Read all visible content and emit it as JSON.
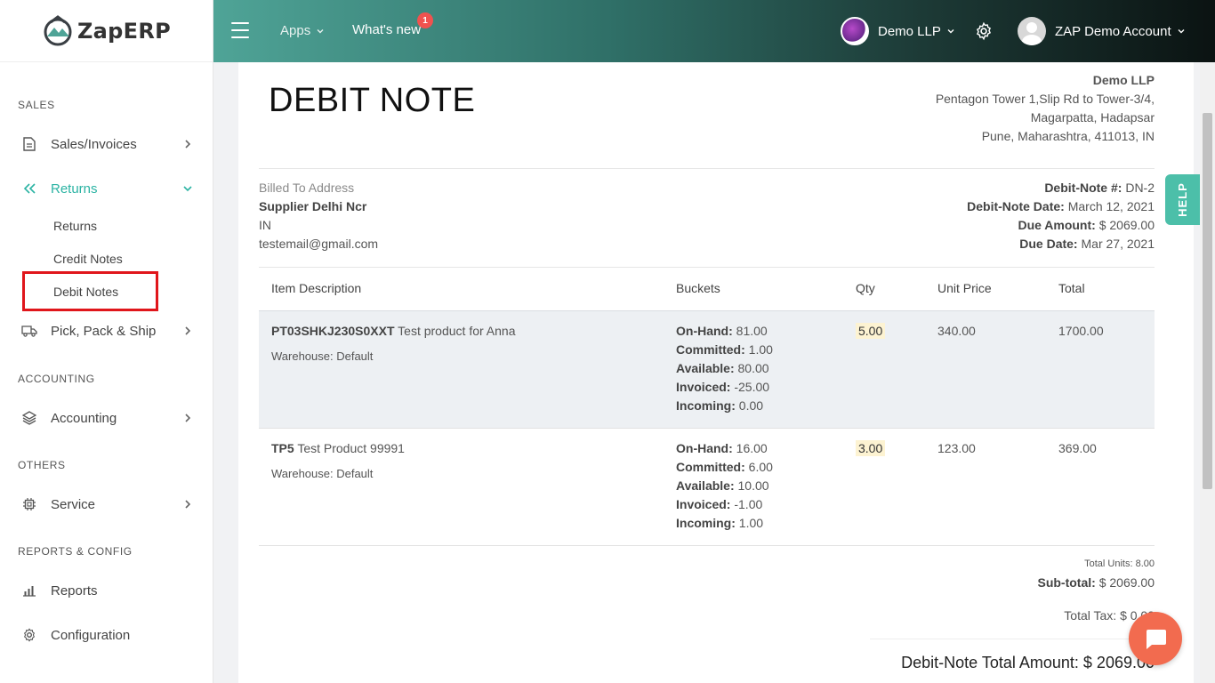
{
  "app": {
    "logo_text": "ZapERP"
  },
  "sidebar": {
    "sections": {
      "sales": "SALES",
      "accounting": "ACCOUNTING",
      "others": "OTHERS",
      "reports": "REPORTS & CONFIG"
    },
    "items": {
      "sales_invoices": "Sales/Invoices",
      "returns": "Returns",
      "pick_pack_ship": "Pick, Pack & Ship",
      "accounting": "Accounting",
      "service": "Service",
      "reports": "Reports",
      "configuration": "Configuration"
    },
    "sub_items": {
      "returns": "Returns",
      "credit_notes": "Credit Notes",
      "debit_notes": "Debit Notes"
    }
  },
  "header": {
    "apps": "Apps",
    "whats_new": "What's new",
    "whats_new_badge": "1",
    "company": "Demo LLP",
    "account": "ZAP Demo Account"
  },
  "document": {
    "title": "DEBIT NOTE",
    "company": {
      "name": "Demo LLP",
      "line1": "Pentagon Tower 1,Slip Rd to Tower-3/4,",
      "line2": "Magarpatta, Hadapsar",
      "line3": "Pune, Maharashtra, 411013, IN"
    },
    "billed": {
      "label": "Billed To Address",
      "name": "Supplier Delhi Ncr",
      "country": "IN",
      "email": "testemail@gmail.com"
    },
    "meta": {
      "number_label": "Debit-Note #:",
      "number": "DN-2",
      "date_label": "Debit-Note Date:",
      "date": "March 12, 2021",
      "due_amount_label": "Due Amount:",
      "due_amount": "$ 2069.00",
      "due_date_label": "Due Date:",
      "due_date": "Mar 27, 2021"
    },
    "columns": {
      "description": "Item Description",
      "buckets": "Buckets",
      "qty": "Qty",
      "unit_price": "Unit Price",
      "total": "Total"
    },
    "bucket_labels": {
      "on_hand": "On-Hand:",
      "committed": "Committed:",
      "available": "Available:",
      "invoiced": "Invoiced:",
      "incoming": "Incoming:"
    },
    "rows": [
      {
        "sku": "PT03SHKJ230S0XXT",
        "name": "Test product for Anna",
        "warehouse": "Warehouse: Default",
        "on_hand": "81.00",
        "committed": "1.00",
        "available": "80.00",
        "invoiced": "-25.00",
        "incoming": "0.00",
        "qty": "5.00",
        "unit_price": "340.00",
        "total": "1700.00"
      },
      {
        "sku": "TP5",
        "name": "Test Product 99991",
        "warehouse": "Warehouse: Default",
        "on_hand": "16.00",
        "committed": "6.00",
        "available": "10.00",
        "invoiced": "-1.00",
        "incoming": "1.00",
        "qty": "3.00",
        "unit_price": "123.00",
        "total": "369.00"
      }
    ],
    "totals": {
      "total_units": "Total Units: 8.00",
      "subtotal_label": "Sub-total:",
      "subtotal": "$ 2069.00",
      "total_tax": "Total Tax: $ 0.00",
      "grand_label": "Debit-Note Total Amount:",
      "grand": "$ 2069.00"
    }
  },
  "widgets": {
    "help": "HELP"
  },
  "colors": {
    "accent": "#2bb3a3",
    "highlight": "#e0161b",
    "chat": "#f26b4f",
    "help": "#4cbfa9"
  }
}
